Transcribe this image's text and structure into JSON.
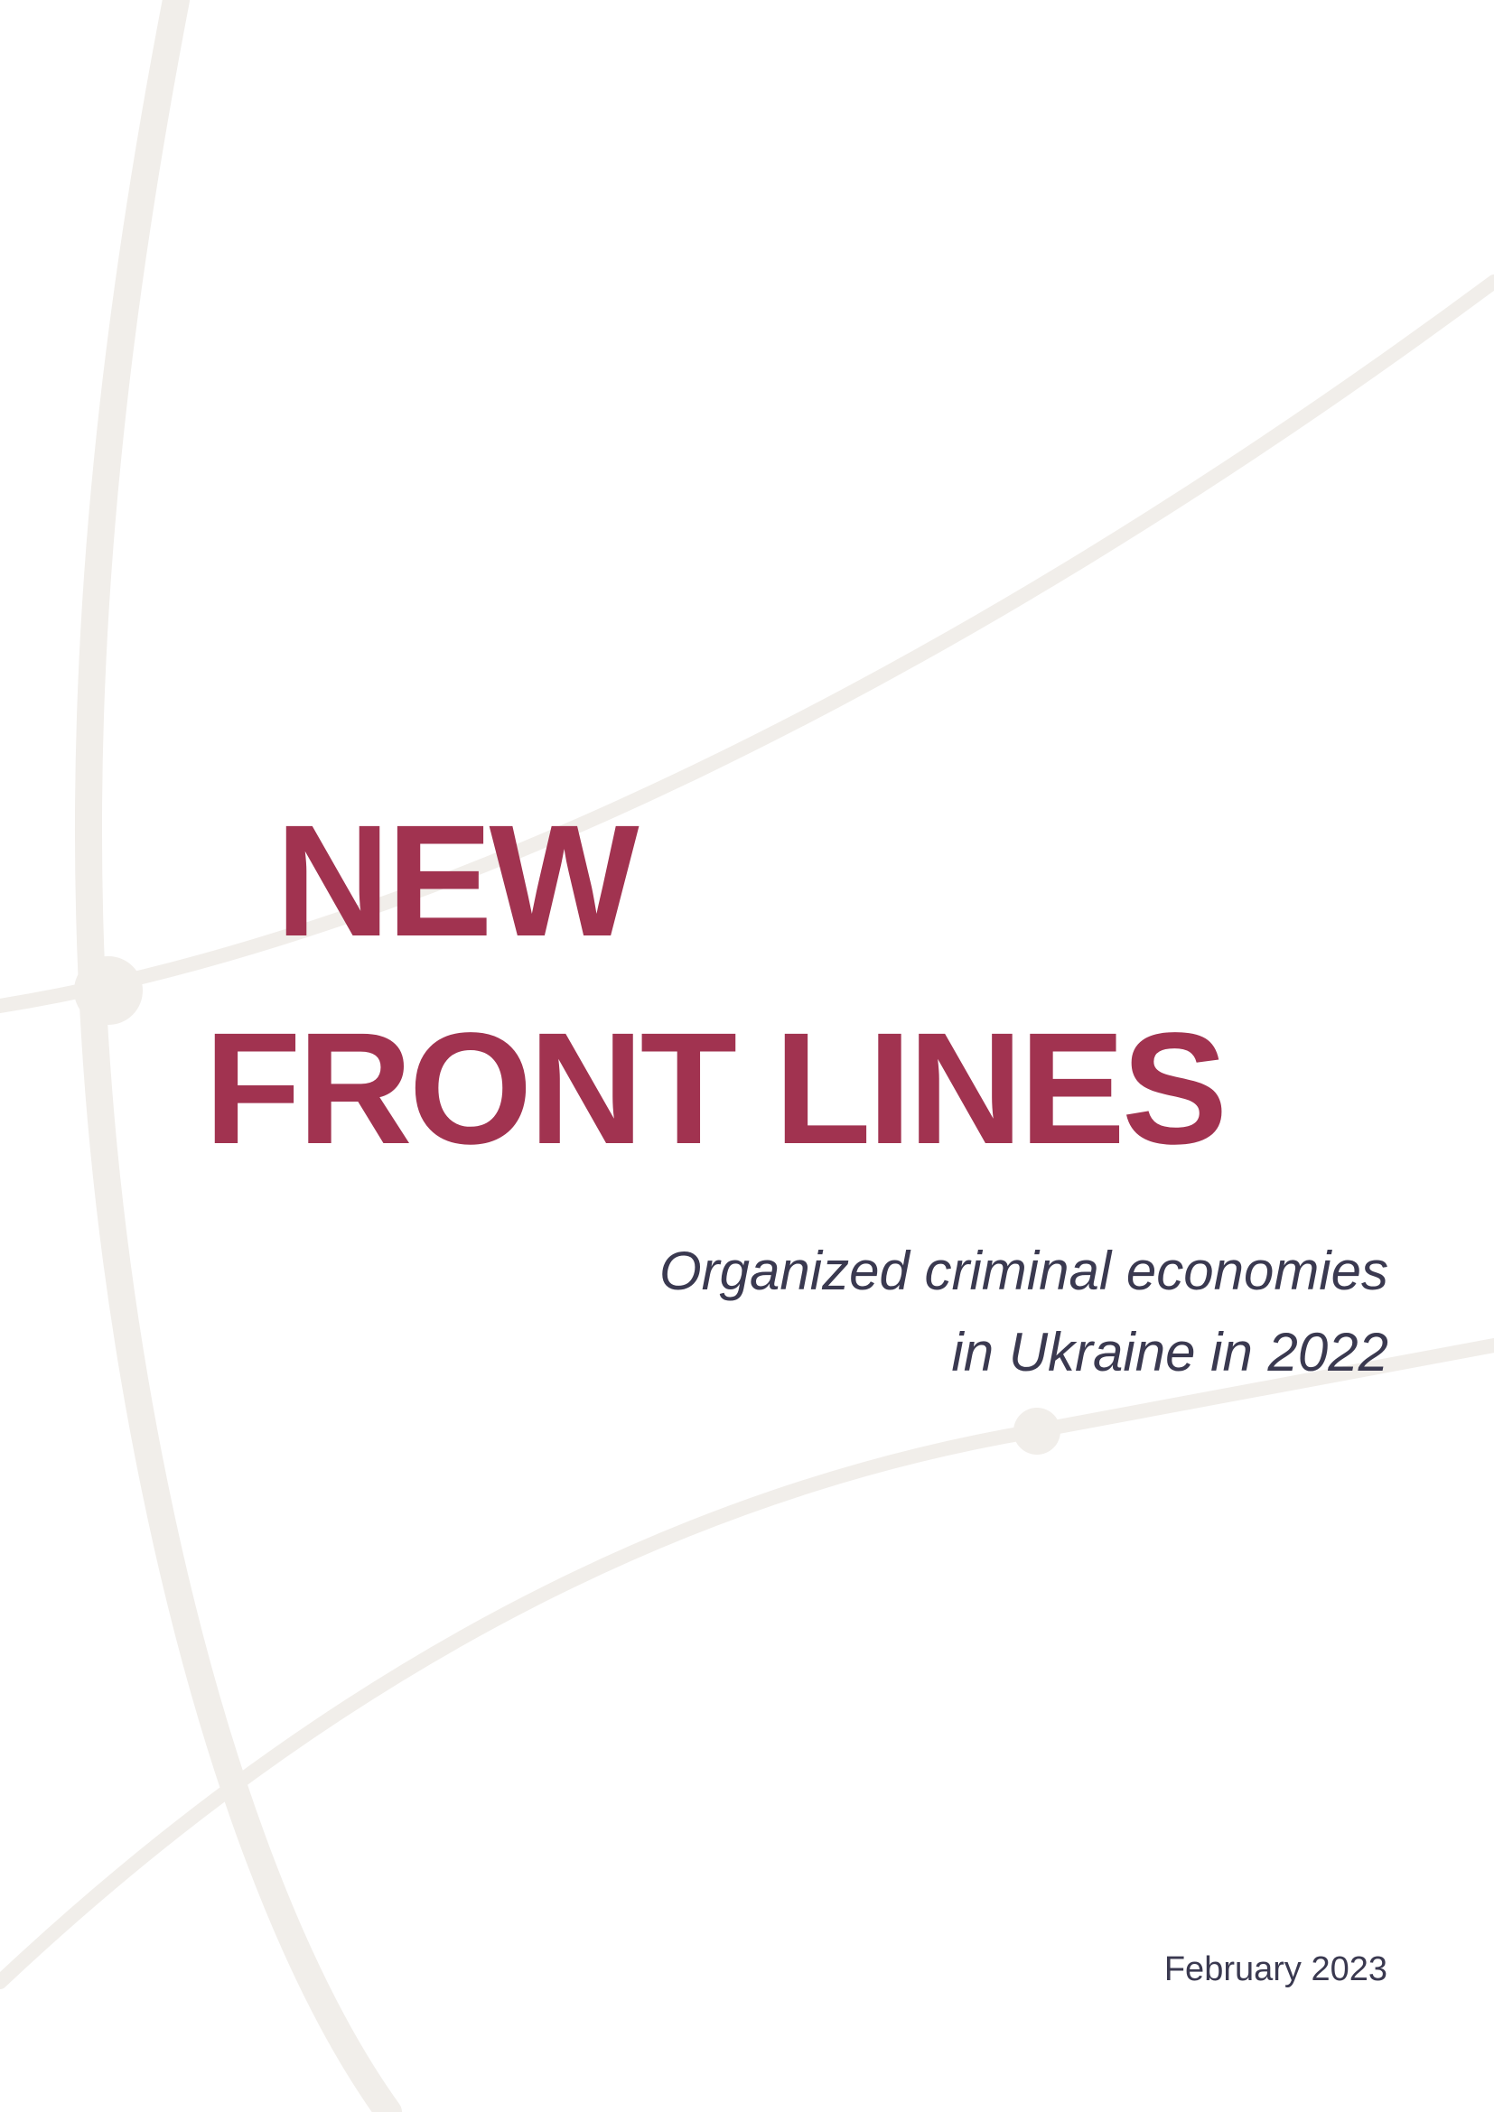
{
  "cover": {
    "title_lines": [
      "NEW",
      "FRONT LINES"
    ],
    "subtitle_lines": [
      "Organized criminal economies",
      "in Ukraine in 2022"
    ],
    "date": "February 2023"
  },
  "colors": {
    "title": "#a13350",
    "subtitle": "#3a3950",
    "date": "#3a3950",
    "background_lines": "#f1eeea",
    "background": "#ffffff"
  }
}
